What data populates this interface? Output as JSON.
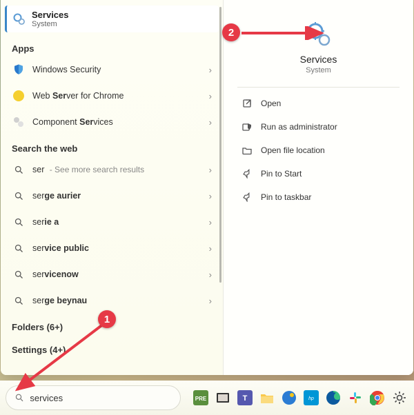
{
  "bestMatch": {
    "title": "Services",
    "subtitle": "System"
  },
  "sections": {
    "apps": "Apps",
    "web": "Search the web",
    "folders": "Folders (6+)",
    "settings": "Settings (4+)"
  },
  "apps": [
    {
      "label": "Windows Security"
    },
    {
      "label": "Web Server for Chrome"
    },
    {
      "label": "Component Services"
    }
  ],
  "webSuggestions": [
    {
      "prefix": "ser",
      "suffix": " - See more search results"
    },
    {
      "label": "serge aurier"
    },
    {
      "label": "serie a"
    },
    {
      "label": "service public"
    },
    {
      "label": "servicenow"
    },
    {
      "label": "serge beynau"
    }
  ],
  "detail": {
    "title": "Services",
    "subtitle": "System",
    "actions": [
      "Open",
      "Run as administrator",
      "Open file location",
      "Pin to Start",
      "Pin to taskbar"
    ]
  },
  "searchInput": {
    "value": "services"
  },
  "annotations": {
    "one": "1",
    "two": "2"
  }
}
